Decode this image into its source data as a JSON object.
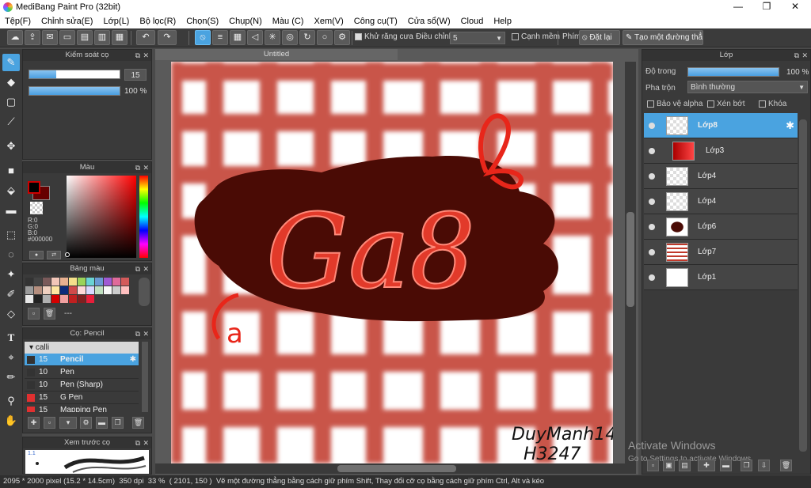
{
  "window": {
    "title": "MediBang Paint Pro (32bit)",
    "minimize": "—",
    "maximize": "❐",
    "close": "✕"
  },
  "menu": [
    "Tệp(F)",
    "Chỉnh sửa(E)",
    "Lớp(L)",
    "Bộ lọc(R)",
    "Chọn(S)",
    "Chụp(N)",
    "Màu (C)",
    "Xem(V)",
    "Công cụ(T)",
    "Cửa sổ(W)",
    "Cloud",
    "Help"
  ],
  "toolbar": {
    "antialias_label": "Khử răng cưa",
    "correction_label": "Điều chỉnh",
    "correction_value": "5",
    "soft_edge_label": "Cạnh mềm",
    "key_label": "Phím",
    "reset_label": "Đặt lại",
    "line_label": "Tạo một đường thẳng"
  },
  "brush_control": {
    "title": "Kiểm soát cọ",
    "size_value": "15",
    "opacity_value": "100 %",
    "opacity_fraction": 1.0,
    "size_fraction": 0.3
  },
  "color_panel": {
    "title": "Màu",
    "r": "R:0",
    "g": "G:0",
    "b": "B:0",
    "hex": "#000000"
  },
  "palette": {
    "title": "Bảng màu",
    "empty": "---",
    "colors": [
      "#333333",
      "#444444",
      "#7a5a5a",
      "#f2c6b8",
      "#e8b090",
      "#f5e08a",
      "#9ad35a",
      "#6ad3d3",
      "#6a9ad3",
      "#a05ad3",
      "#e06a9a",
      "#d35a5a",
      "#9a9a9a",
      "#b58e7e",
      "#f0d0c0",
      "#ffe6a0",
      "#0c2a7a",
      "#d04a4a",
      "#ffd8d8",
      "#d8d8ff",
      "#c0e0c0",
      "#f8f8f8",
      "#cccccc",
      "#ffc0c0",
      "#e8e8e8",
      "#222222",
      "#b0b0b0",
      "#d40000",
      "#f0a0a0",
      "#c02020",
      "#802020",
      "#e81e3a"
    ]
  },
  "brush_list": {
    "title": "Cọ: Pencil",
    "group": "calli",
    "items": [
      {
        "size": "15",
        "name": "Pencil",
        "color": "#333333",
        "selected": true
      },
      {
        "size": "10",
        "name": "Pen",
        "color": "#333333",
        "selected": false
      },
      {
        "size": "10",
        "name": "Pen (Sharp)",
        "color": "#333333",
        "selected": false
      },
      {
        "size": "15",
        "name": "G Pen",
        "color": "#e03030",
        "selected": false
      },
      {
        "size": "15",
        "name": "Mapping Pen",
        "color": "#e03030",
        "selected": false
      }
    ]
  },
  "brush_preview": {
    "title": "Xem trước cọ",
    "size": "1.1"
  },
  "canvas": {
    "tab": "Untitled",
    "art_text": "Ga8",
    "small_text": "a",
    "signature_line1": "DuyManh14",
    "signature_line2": "H3247"
  },
  "layers": {
    "title": "Lớp",
    "opacity_label": "Độ trong",
    "opacity_value": "100 %",
    "opacity_fraction": 1.0,
    "blend_label": "Pha trộn",
    "blend_value": "Bình thường",
    "protect_alpha": "Bảo vệ alpha",
    "clip": "Xén bớt",
    "lock": "Khóa",
    "items": [
      {
        "name": "Lớp8",
        "selected": true
      },
      {
        "name": "Lớp3",
        "selected": false
      },
      {
        "name": "Lớp4",
        "selected": false
      },
      {
        "name": "Lớp4",
        "selected": false
      },
      {
        "name": "Lớp6",
        "selected": false
      },
      {
        "name": "Lớp7",
        "selected": false
      },
      {
        "name": "Lớp1",
        "selected": false
      }
    ]
  },
  "watermark": {
    "line1": "Activate Windows",
    "line2": "Go to Settings to activate Windows."
  },
  "status": {
    "size": "2095 * 2000 pixel",
    "physical": "(15.2 * 14.5cm)",
    "dpi": "350 dpi",
    "zoom": "33 %",
    "coords": "( 2101, 150 )",
    "hint": "Vẽ một đường thẳng bằng cách giữ phím Shift, Thay đổi cỡ cọ bằng cách giữ phím Ctrl, Alt và kéo"
  }
}
